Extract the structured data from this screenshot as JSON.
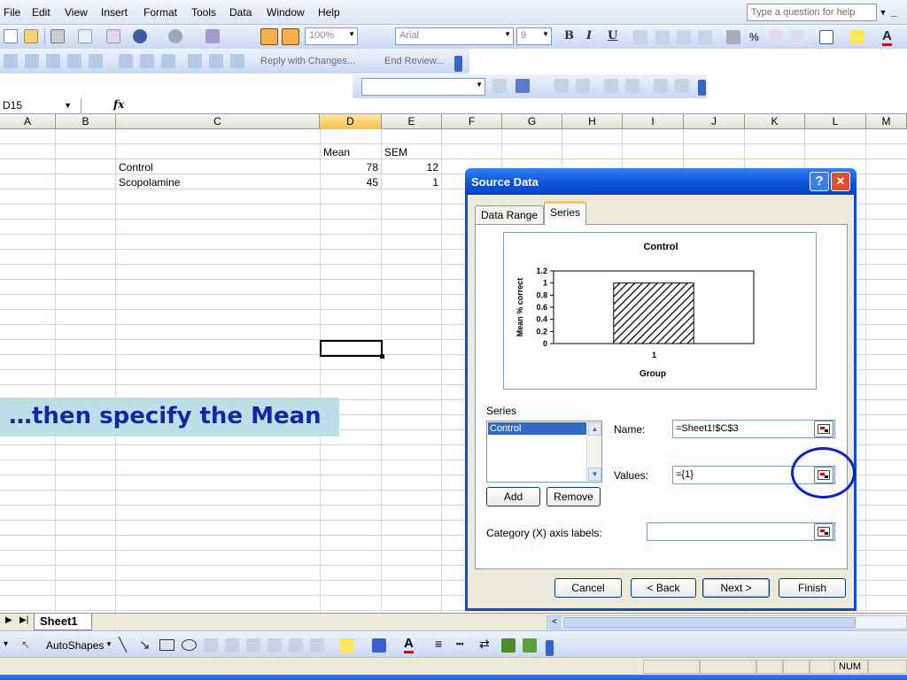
{
  "menu": [
    "File",
    "Edit",
    "View",
    "Insert",
    "Format",
    "Tools",
    "Data",
    "Window",
    "Help"
  ],
  "help_placeholder": "Type a question for help",
  "toolbar": {
    "zoom": "100%",
    "font": "Arial",
    "font_size": "9",
    "bold": "B",
    "italic": "I",
    "underline": "U",
    "percent": "%",
    "reply_changes": "Reply with Changes...",
    "end_review": "End Review..."
  },
  "formula_bar": {
    "name_box": "D15",
    "fx": "fx",
    "content": ""
  },
  "columns": [
    "A",
    "B",
    "C",
    "D",
    "E",
    "F",
    "G",
    "H",
    "I",
    "J",
    "K",
    "L",
    "M"
  ],
  "active_column": "D",
  "cells": {
    "header_mean": "Mean",
    "header_sem": "SEM",
    "row1_label": "Control",
    "row1_mean": "78",
    "row1_sem": "12",
    "row2_label": "Scopolamine",
    "row2_mean": "45",
    "row2_sem": "1"
  },
  "callout_text": "…then specify the Mean",
  "sheet": {
    "tab": "Sheet1"
  },
  "drawing_toolbar": {
    "autoshapes": "AutoShapes"
  },
  "status": {
    "num": "NUM"
  },
  "dialog": {
    "title": "Source Data",
    "help_button": "?",
    "close_button": "✕",
    "tabs": [
      "Data Range",
      "Series"
    ],
    "active_tab": "Series",
    "series_label": "Series",
    "series_items": [
      "Control"
    ],
    "name_label": "Name:",
    "name_value": "=Sheet1!$C$3",
    "values_label": "Values:",
    "values_value": "={1}",
    "category_label": "Category (X) axis labels:",
    "category_value": "",
    "add": "Add",
    "remove": "Remove",
    "cancel": "Cancel",
    "back": "< Back",
    "next": "Next >",
    "finish": "Finish"
  },
  "chart_data": {
    "type": "bar",
    "title": "Control",
    "xlabel": "Group",
    "ylabel": "Mean % correct",
    "categories": [
      "1"
    ],
    "values": [
      1
    ],
    "ylim": [
      0,
      1.2
    ],
    "yticks": [
      "1.2",
      "1",
      "0.8",
      "0.6",
      "0.4",
      "0.2",
      "0"
    ],
    "fill": "diagonal-hatch",
    "grid": false,
    "legend": "none"
  }
}
